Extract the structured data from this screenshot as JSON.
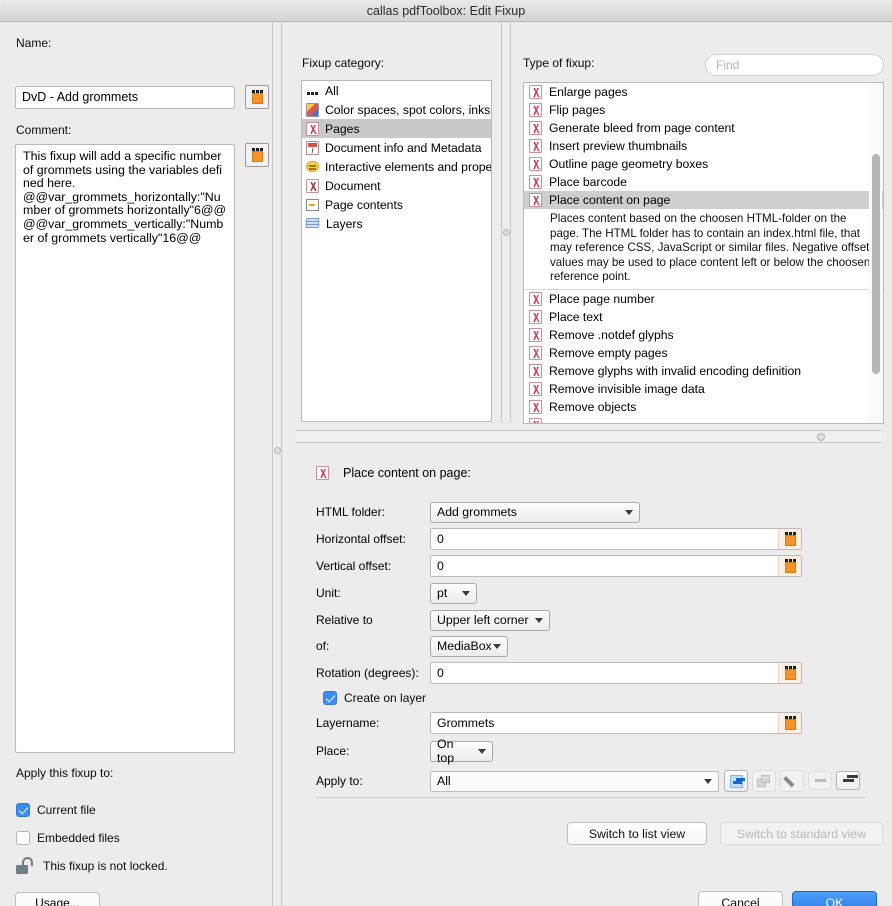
{
  "window": {
    "title": "callas pdfToolbox: Edit Fixup"
  },
  "left": {
    "name_label": "Name:",
    "name_value": "DvD - Add grommets",
    "name_variable_icon": "orange-variable-icon",
    "comment_label": "Comment:",
    "comment_value": "This fixup will add a specific number of grommets using the variables defined here.\n@@var_grommets_horizontally:\"Number of grommets horizontally\"6@@@@var_grommets_vertically:\"Number of grommets vertically\"16@@",
    "comment_variable_icon": "orange-variable-icon",
    "apply_label": "Apply this fixup to:",
    "checkboxes": [
      {
        "label": "Current file",
        "checked": true
      },
      {
        "label": "Embedded files",
        "checked": false
      }
    ],
    "lock_text": "This fixup is not locked.",
    "lock_icon": "unlocked-padlock-icon",
    "usage_button": "Usage..."
  },
  "category": {
    "label": "Fixup category:",
    "items": [
      {
        "label": "All",
        "icon": "ellipsis-icon",
        "selected": false
      },
      {
        "label": "Color spaces, spot colors, inks",
        "icon": "color-swatch-icon",
        "selected": false
      },
      {
        "label": "Pages",
        "icon": "pdf-page-icon",
        "selected": true
      },
      {
        "label": "Document info and Metadata",
        "icon": "document-info-icon",
        "selected": false
      },
      {
        "label": "Interactive elements and properties",
        "icon": "comment-bubble-icon",
        "selected": false
      },
      {
        "label": "Document",
        "icon": "pdf-document-icon",
        "selected": false
      },
      {
        "label": "Page contents",
        "icon": "page-contents-icon",
        "selected": false
      },
      {
        "label": "Layers",
        "icon": "layers-icon",
        "selected": false
      }
    ]
  },
  "typeoffixup": {
    "label": "Type of fixup:",
    "find_placeholder": "Find",
    "items": [
      {
        "label": "Enlarge pages",
        "selected": false
      },
      {
        "label": "Flip pages",
        "selected": false
      },
      {
        "label": "Generate bleed from page content",
        "selected": false
      },
      {
        "label": "Insert preview thumbnails",
        "selected": false
      },
      {
        "label": "Outline page geometry boxes",
        "selected": false
      },
      {
        "label": "Place barcode",
        "selected": false
      },
      {
        "label": "Place content on page",
        "selected": true
      },
      {
        "label": "Place page number",
        "selected": false
      },
      {
        "label": "Place text",
        "selected": false
      },
      {
        "label": "Remove .notdef glyphs",
        "selected": false
      },
      {
        "label": "Remove empty pages",
        "selected": false
      },
      {
        "label": "Remove glyphs with invalid encoding definition",
        "selected": false
      },
      {
        "label": "Remove invisible image data",
        "selected": false
      },
      {
        "label": "Remove objects",
        "selected": false
      }
    ],
    "description": "Places content based on the choosen HTML-folder on the page. The HTML folder has to contain an index.html file, that may reference CSS, JavaScript or similar files. Negative offset values may be used to place content left or below the choosen reference point."
  },
  "form": {
    "title": "Place content on page:",
    "title_icon": "pdf-page-icon",
    "html_folder_label": "HTML folder:",
    "html_folder_value": "Add grommets",
    "horizontal_offset_label": "Horizontal offset:",
    "horizontal_offset_value": "0",
    "vertical_offset_label": "Vertical offset:",
    "vertical_offset_value": "0",
    "unit_label": "Unit:",
    "unit_value": "pt",
    "relative_to_label": "Relative to",
    "relative_to_value": "Upper left corner",
    "of_label": "of:",
    "of_value": "MediaBox",
    "rotation_label": "Rotation (degrees):",
    "rotation_value": "0",
    "create_on_layer_label": "Create on layer",
    "create_on_layer_checked": true,
    "layername_label": "Layername:",
    "layername_value": "Grommets",
    "place_label": "Place:",
    "place_value": "On top",
    "apply_to_label": "Apply to:",
    "apply_to_value": "All",
    "apply_to_buttons": [
      {
        "icon": "add-blue-plus-icon",
        "enabled": true
      },
      {
        "icon": "duplicate-icon",
        "enabled": false
      },
      {
        "icon": "edit-pencil-icon",
        "enabled": true
      },
      {
        "icon": "minus-icon",
        "enabled": false
      },
      {
        "icon": "plus-icon",
        "enabled": true
      }
    ]
  },
  "footer": {
    "switch_list_view": "Switch to list view",
    "switch_standard_view": "Switch to standard view",
    "cancel": "Cancel",
    "ok": "OK"
  }
}
